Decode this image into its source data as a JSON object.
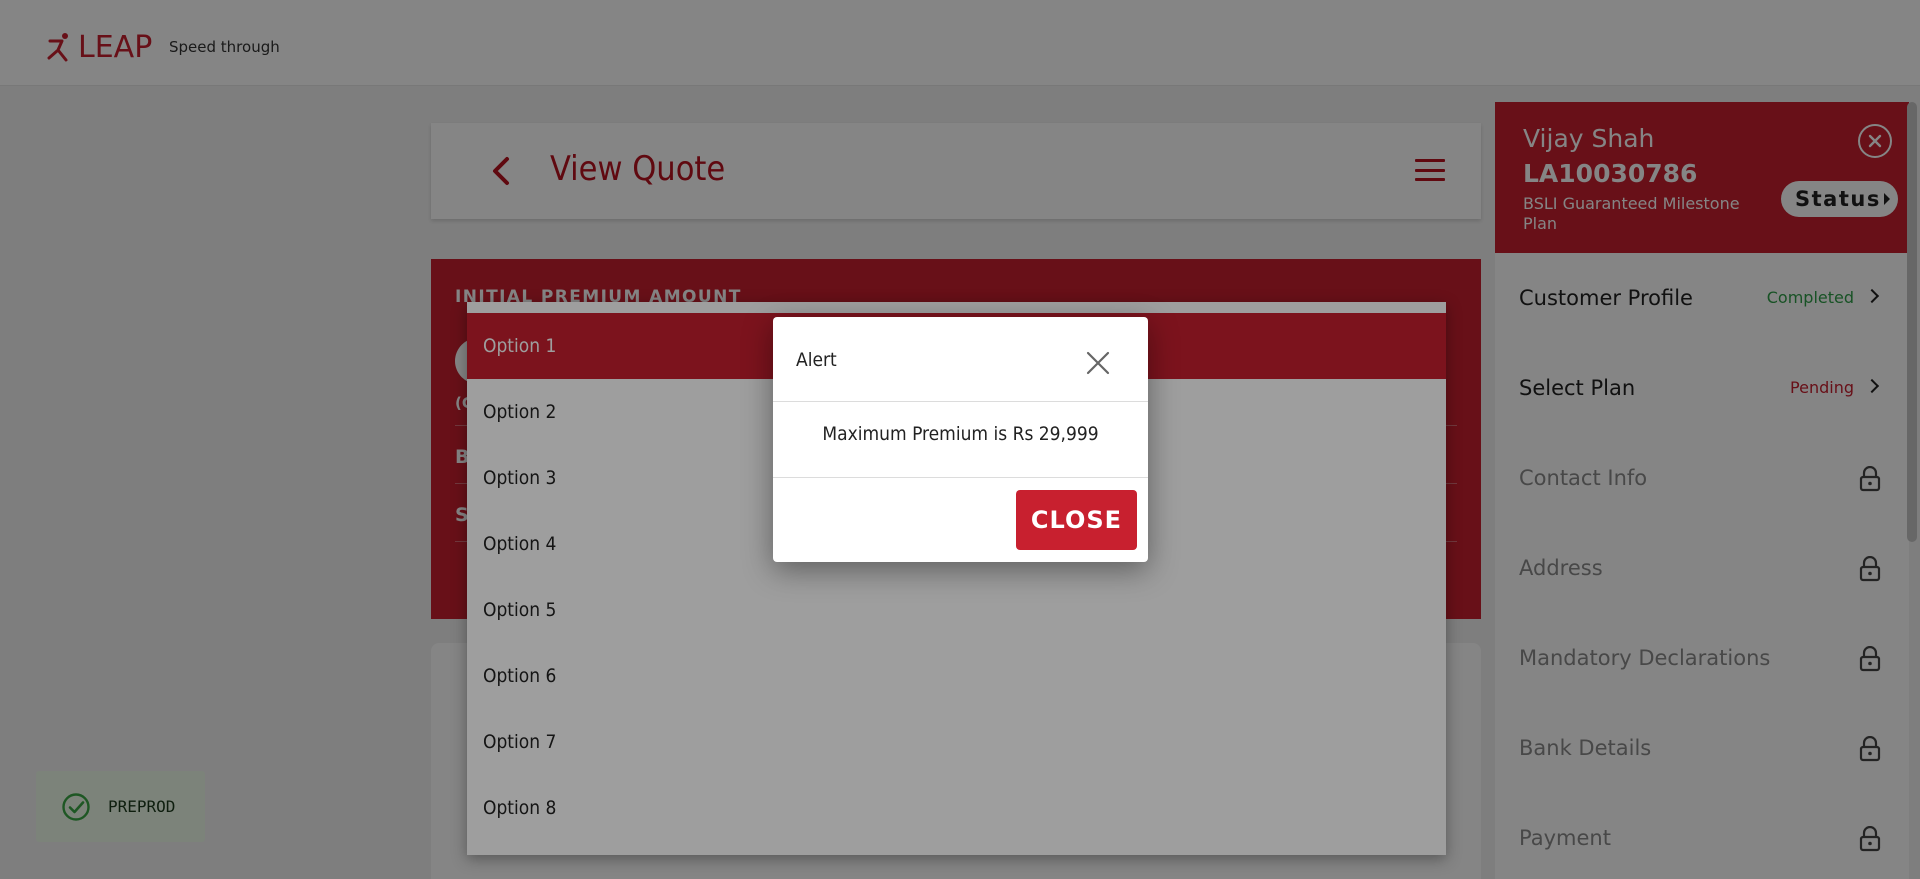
{
  "header": {
    "logo_text": "LEAP",
    "tagline": "Speed through"
  },
  "quote": {
    "title": "View Quote"
  },
  "premium": {
    "label": "INITIAL PREMIUM AMOUNT",
    "sub_partial": "(G",
    "row1_partial": "B",
    "row2_partial": "S"
  },
  "sidebar": {
    "name": "Vijay Shah",
    "application_id": "LA10030786",
    "plan": "BSLI Guaranteed Milestone Plan",
    "status_label": "Status",
    "items": [
      {
        "label": "Customer Profile",
        "status": "Completed",
        "status_color": "#2e9e48",
        "state": "open"
      },
      {
        "label": "Select Plan",
        "status": "Pending",
        "status_color": "#c8202f",
        "state": "open"
      },
      {
        "label": "Contact Info",
        "status": "",
        "state": "locked"
      },
      {
        "label": "Address",
        "status": "",
        "state": "locked"
      },
      {
        "label": "Mandatory Declarations",
        "status": "",
        "state": "locked"
      },
      {
        "label": "Bank Details",
        "status": "",
        "state": "locked"
      },
      {
        "label": "Payment",
        "status": "",
        "state": "locked"
      }
    ]
  },
  "dropdown": {
    "selected_index": 0,
    "options": [
      "Option 1",
      "Option 2",
      "Option 3",
      "Option 4",
      "Option 5",
      "Option 6",
      "Option 7",
      "Option 8"
    ]
  },
  "alert": {
    "title": "Alert",
    "message": "Maximum Premium is Rs 29,999",
    "close_label": "CLOSE"
  },
  "environment": {
    "label": "PREPROD"
  },
  "colors": {
    "brand_red": "#c8202f",
    "dark_red": "#b8121f",
    "success_green": "#2e9e48"
  }
}
